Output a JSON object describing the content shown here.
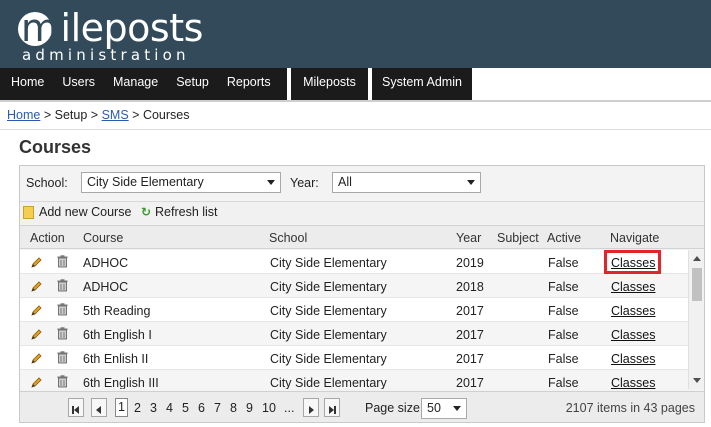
{
  "brand": {
    "logo_word": "mileposts",
    "logo_first": "m",
    "logo_rest": "ileposts",
    "logo_sub": "administration"
  },
  "nav": {
    "items": [
      "Home",
      "Users",
      "Manage",
      "Setup",
      "Reports"
    ],
    "mileposts": "Mileposts",
    "system_admin": "System Admin"
  },
  "breadcrumb": {
    "home": "Home",
    "sep1": ">",
    "setup": "Setup",
    "sep2": ">",
    "sms": "SMS",
    "sep3": ">",
    "current": "Courses"
  },
  "page": {
    "title": "Courses"
  },
  "filters": {
    "school_label": "School:",
    "school_value": "City Side Elementary",
    "year_label": "Year:",
    "year_value": "All"
  },
  "toolbar": {
    "add_label": "Add new Course",
    "refresh_label": "Refresh list"
  },
  "grid": {
    "columns": [
      "Action",
      "Course",
      "School",
      "Year",
      "Subject",
      "Active",
      "Navigate"
    ],
    "rows": [
      {
        "course": "ADHOC",
        "school": "City Side Elementary",
        "year": "2019",
        "subject": "",
        "active": "False",
        "navigate": "Classes"
      },
      {
        "course": "ADHOC",
        "school": "City Side Elementary",
        "year": "2018",
        "subject": "",
        "active": "False",
        "navigate": "Classes"
      },
      {
        "course": "5th Reading",
        "school": "City Side Elementary",
        "year": "2017",
        "subject": "",
        "active": "False",
        "navigate": "Classes"
      },
      {
        "course": "6th English I",
        "school": "City Side Elementary",
        "year": "2017",
        "subject": "",
        "active": "False",
        "navigate": "Classes"
      },
      {
        "course": "6th Enlish II",
        "school": "City Side Elementary",
        "year": "2017",
        "subject": "",
        "active": "False",
        "navigate": "Classes"
      },
      {
        "course": "6th English III",
        "school": "City Side Elementary",
        "year": "2017",
        "subject": "",
        "active": "False",
        "navigate": "Classes"
      }
    ]
  },
  "pager": {
    "pages": [
      "1",
      "2",
      "3",
      "4",
      "5",
      "6",
      "7",
      "8",
      "9",
      "10",
      "..."
    ],
    "current_page": "1",
    "page_size_label": "Page size:",
    "page_size_value": "50",
    "info": "2107 items in 43 pages"
  },
  "colors": {
    "banner": "#324a5a",
    "nav": "#1b1b1b",
    "link": "#2a5db0",
    "highlight": "#e0262b"
  },
  "icons": {
    "edit": "pencil-icon",
    "delete": "trash-icon",
    "add": "page-add-icon",
    "refresh": "refresh-icon"
  }
}
